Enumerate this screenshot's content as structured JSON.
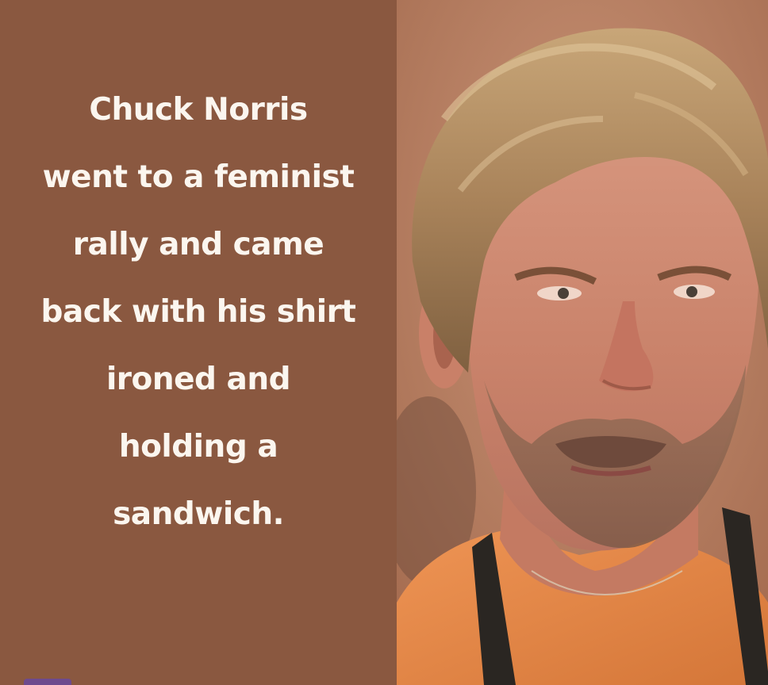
{
  "caption": {
    "lines": [
      "Chuck Norris",
      "went to a feminist",
      "rally and came",
      "back with his shirt",
      "ironed and",
      "holding a",
      "sandwich."
    ]
  },
  "colors": {
    "text_panel_bg": "#8a5840",
    "caption_text": "#fbf6ef",
    "shirt": "#e48a4a"
  }
}
